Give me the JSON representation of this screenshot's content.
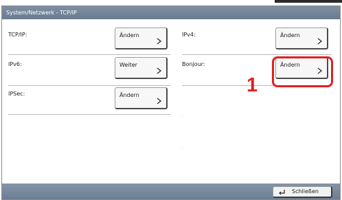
{
  "window": {
    "title": "System/Netzwerk - TCP/IP"
  },
  "settings": [
    {
      "label": "TCP/IP:",
      "button": "Ändern"
    },
    {
      "label": "IPv4:",
      "button": "Ändern"
    },
    {
      "label": "IPv6:",
      "button": "Weiter"
    },
    {
      "label": "Bonjour:",
      "button": "Ändern"
    },
    {
      "label": "IPSec:",
      "button": "Ändern"
    }
  ],
  "annotation": {
    "step_number": "1",
    "color": "#e02020"
  },
  "footer": {
    "close_label": "Schließen",
    "close_icon": "return-arrow-icon"
  },
  "colors": {
    "titlebar": "#7f8fa3",
    "highlight": "#e02020"
  }
}
